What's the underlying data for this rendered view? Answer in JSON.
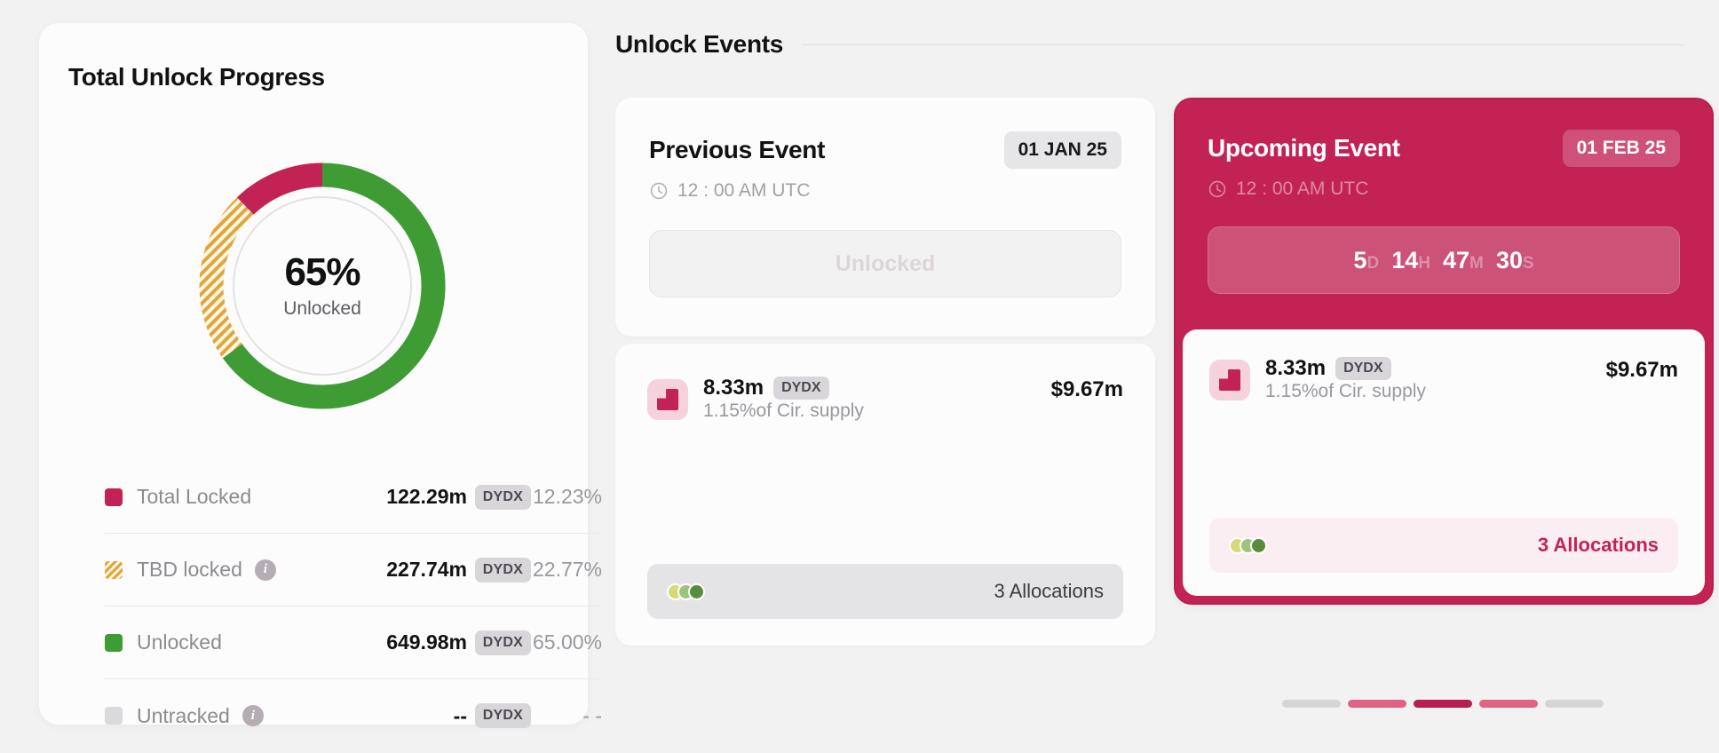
{
  "theme": {
    "bg": "#f2f2f3",
    "crimson": "#c32354",
    "green": "#3f9c35",
    "gold": "#e0a63a",
    "gray": "#dbd9dc"
  },
  "progress_panel": {
    "title": "Total Unlock Progress",
    "donut": {
      "center_value": "65%",
      "center_label": "Unlocked"
    },
    "legend": [
      {
        "label": "Total Locked",
        "swatch": "locked",
        "has_info": false,
        "amount": "122.29m",
        "ticker": "DYDX",
        "percent": "12.23%"
      },
      {
        "label": "TBD locked",
        "swatch": "tbd",
        "has_info": true,
        "info_icon": "info-icon",
        "amount": "227.74m",
        "ticker": "DYDX",
        "percent": "22.77%"
      },
      {
        "label": "Unlocked",
        "swatch": "unlocked",
        "has_info": false,
        "amount": "649.98m",
        "ticker": "DYDX",
        "percent": "65.00%"
      },
      {
        "label": "Untracked",
        "swatch": "untracked",
        "has_info": true,
        "info_icon": "info-icon",
        "amount": "--",
        "ticker": "DYDX",
        "percent": "- -"
      }
    ]
  },
  "events": {
    "section_title": "Unlock Events",
    "previous": {
      "name": "Previous Event",
      "date": "01 JAN 25",
      "clock_icon": "clock-icon",
      "time": "12 : 00 AM UTC",
      "status_button": "Unlocked",
      "allocation": {
        "token_icon": "dydx-token-icon",
        "amount": "8.33m",
        "ticker": "DYDX",
        "sub": "1.15%of Cir. supply",
        "usd": "$9.67m"
      },
      "footer": {
        "count_label": "3 Allocations",
        "dot_colors": [
          "#d6d977",
          "#9dc37c",
          "#5a8c40"
        ]
      }
    },
    "upcoming": {
      "name": "Upcoming Event",
      "date": "01 FEB 25",
      "clock_icon": "clock-icon",
      "time": "12 : 00 AM UTC",
      "countdown": {
        "days": "5",
        "days_unit": "D",
        "hours": "14",
        "hours_unit": "H",
        "minutes": "47",
        "minutes_unit": "M",
        "seconds": "30",
        "seconds_unit": "S"
      },
      "allocation": {
        "token_icon": "dydx-token-icon",
        "amount": "8.33m",
        "ticker": "DYDX",
        "sub": "1.15%of Cir. supply",
        "usd": "$9.67m"
      },
      "footer": {
        "count_label": "3 Allocations",
        "dot_colors": [
          "#d6d977",
          "#9dc37c",
          "#5a8c40"
        ]
      }
    },
    "pagination": {
      "bars": [
        "#d6d4d7",
        "#e06384",
        "#b51f4f",
        "#e06384",
        "#d6d4d7"
      ]
    }
  },
  "chart_data": {
    "type": "pie",
    "title": "Total Unlock Progress",
    "categories": [
      "Unlocked",
      "Total Locked",
      "TBD locked",
      "Untracked"
    ],
    "values": [
      65.0,
      12.23,
      22.77,
      0
    ],
    "amounts": [
      "649.98m",
      "122.29m",
      "227.74m",
      "--"
    ],
    "unit": "DYDX",
    "colors": [
      "#3f9c35",
      "#c32354",
      "#e0a63a",
      "#dbd9dc"
    ],
    "center_value": "65%",
    "center_label": "Unlocked",
    "legend_position": "below",
    "grid": false
  }
}
